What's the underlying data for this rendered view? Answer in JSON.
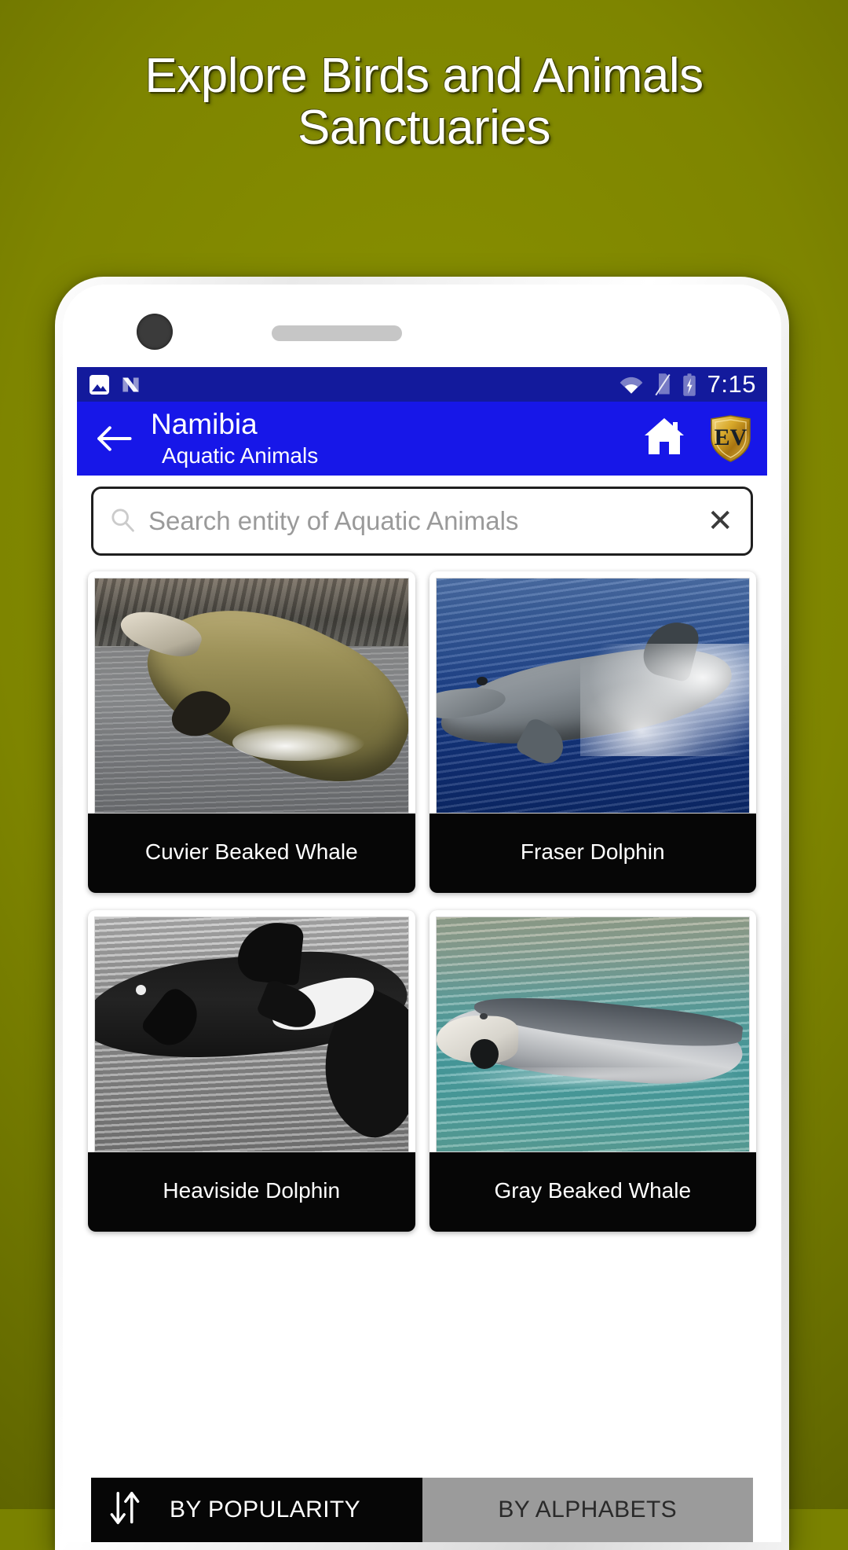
{
  "promo": {
    "headline": "Explore Birds and Animals\nSanctuaries",
    "background_color": "#7a8200",
    "headline_color": "#ffffff"
  },
  "device": {
    "frame_color": "#e9e9e9",
    "camera_icon": "camera-lens",
    "speaker_icon": "speaker-grille"
  },
  "status_bar": {
    "background_color": "#131a9c",
    "clock": "7:15",
    "left_icons": [
      "photo-icon",
      "android-n-icon"
    ],
    "right_icons": [
      "wifi-icon",
      "no-sim-icon",
      "battery-charging-icon"
    ]
  },
  "app_bar": {
    "background_color": "#1717e8",
    "back_icon": "back-arrow-icon",
    "title": "Namibia",
    "subtitle": "Aquatic Animals",
    "home_icon": "home-icon",
    "logo_text": "EV",
    "logo_icon": "ev-shield-logo",
    "logo_color": "#d4a017"
  },
  "search": {
    "icon": "search-icon",
    "value": "",
    "placeholder": "Search entity of Aquatic Animals",
    "clear_icon": "close-icon",
    "clear_label": "✕"
  },
  "grid": {
    "cards": [
      {
        "label": "Cuvier Beaked Whale",
        "art": "ph-cuvier"
      },
      {
        "label": "Fraser Dolphin",
        "art": "ph-fraser"
      },
      {
        "label": "Heaviside Dolphin",
        "art": "ph-heaviside"
      },
      {
        "label": "Gray Beaked Whale",
        "art": "ph-gray"
      }
    ]
  },
  "sort_bar": {
    "sort_icon": "sort-arrows-icon",
    "popularity_label": "BY POPULARITY",
    "alphabets_label": "BY ALPHABETS",
    "active_tab": "BY POPULARITY",
    "active_background": "#060606",
    "inactive_background": "#9b9b9b"
  }
}
